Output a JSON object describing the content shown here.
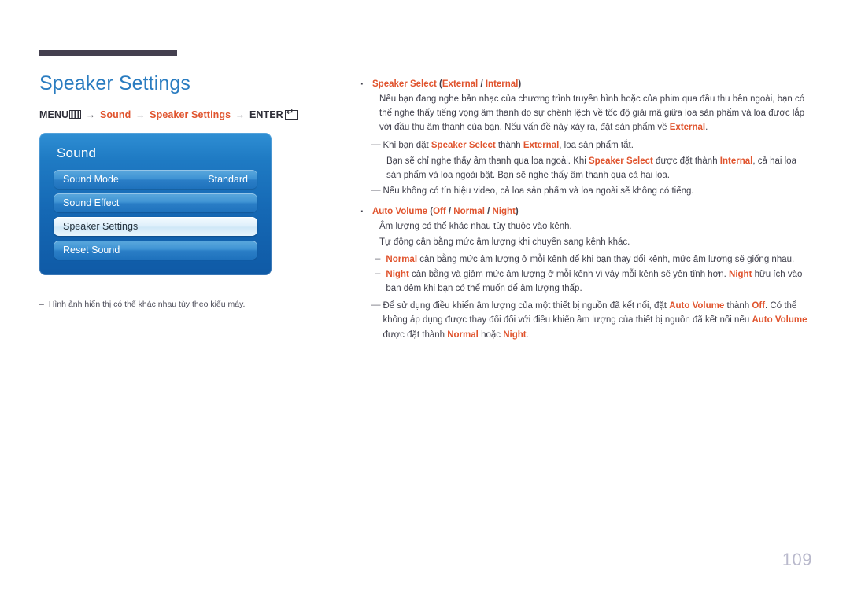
{
  "page": {
    "number": "109",
    "title": "Speaker Settings"
  },
  "menu_path": {
    "menu_label": "MENU",
    "arrow": "→",
    "step1": "Sound",
    "step2": "Speaker Settings",
    "enter_label": "ENTER",
    "menu_icon": "menu-bars-icon",
    "enter_icon": "enter-return-icon"
  },
  "osd": {
    "title": "Sound",
    "items": [
      {
        "label": "Sound Mode",
        "value": "Standard",
        "selected": false
      },
      {
        "label": "Sound Effect",
        "value": "",
        "selected": false
      },
      {
        "label": "Speaker Settings",
        "value": "",
        "selected": true
      },
      {
        "label": "Reset Sound",
        "value": "",
        "selected": false
      }
    ]
  },
  "footnote": {
    "dash": "–",
    "text": "Hình ảnh hiển thị có thể khác nhau tùy theo kiểu máy."
  },
  "content": {
    "bullet_dot": "·",
    "em_dash": "—",
    "sub_dash": "–",
    "speaker_select": {
      "title_main": "Speaker Select",
      "title_options": " (External / Internal)",
      "opt_external": "External",
      "opt_internal": "Internal",
      "paren_open": " (",
      "slash": " / ",
      "paren_close": ")",
      "body_p1": "Nếu bạn đang nghe bản nhạc của chương trình truyền hình hoặc của phim qua đầu thu bên ngoài, bạn có thể nghe thấy tiếng vọng âm thanh do sự chênh lệch về tốc độ giải mã giữa loa sản phẩm và loa được lắp với đầu thu âm thanh của bạn. Nếu vấn đề này xảy ra, đặt sản phẩm về ",
      "body_p1_end": "External",
      "body_p1_period": ".",
      "note1_a": "Khi bạn đặt ",
      "note1_b": "Speaker Select",
      "note1_c": " thành ",
      "note1_d": "External",
      "note1_e": ", loa sản phẩm tắt.",
      "note1_cont_a": "Bạn sẽ chỉ nghe thấy âm thanh qua loa ngoài. Khi ",
      "note1_cont_b": "Speaker Select",
      "note1_cont_c": " được đặt thành ",
      "note1_cont_d": "Internal",
      "note1_cont_e": ", cả hai loa sản phẩm và loa ngoài bật. Bạn sẽ nghe thấy âm thanh qua cả hai loa.",
      "note2": "Nếu không có tín hiệu video, cả loa sản phẩm và loa ngoài sẽ không có tiếng."
    },
    "auto_volume": {
      "title_main": "Auto Volume",
      "opt_off": "Off",
      "opt_normal": "Normal",
      "opt_night": "Night",
      "paren_open": " (",
      "slash": " / ",
      "paren_close": ")",
      "body_l1": "Âm lượng có thể khác nhau tùy thuộc vào kênh.",
      "body_l2": "Tự động cân bằng mức âm lượng khi chuyển sang kênh khác.",
      "sub1_a": "Normal",
      "sub1_b": " cân bằng mức âm lượng ở mỗi kênh để khi bạn thay đổi kênh, mức âm lượng sẽ giống nhau.",
      "sub2_a": "Night",
      "sub2_b": " cân bằng và giảm mức âm lượng ở mỗi kênh vì vậy mỗi kênh sẽ yên tĩnh hơn. ",
      "sub2_c": "Night",
      "sub2_d": " hữu ích vào ban đêm khi bạn có thể muốn để âm lượng thấp.",
      "note_a": "Để sử dụng điều khiển âm lượng của một thiết bị nguồn đã kết nối, đặt ",
      "note_b": "Auto Volume",
      "note_c": " thành ",
      "note_d": "Off",
      "note_e": ". Có thể không áp dụng được thay đổi đối với điều khiển âm lượng của thiết bị nguồn đã kết nối nếu ",
      "note_f": "Auto Volume",
      "note_g": " được đặt thành ",
      "note_h": "Normal",
      "note_i": " hoặc ",
      "note_j": "Night",
      "note_k": "."
    }
  },
  "colors": {
    "accent_orange": "#e0542e",
    "title_blue": "#2a7cc0",
    "panel_blue_top": "#2f8fd4",
    "panel_blue_bottom": "#0f5aa6",
    "rule_dark": "#44404f",
    "page_number": "#b9b9cc"
  }
}
